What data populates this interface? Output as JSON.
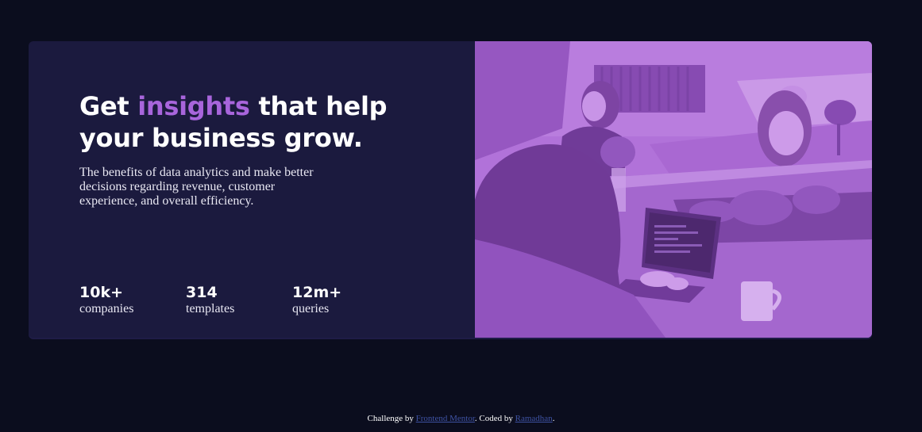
{
  "hero": {
    "headline_part1": "Get ",
    "headline_accent": "insights",
    "headline_part2": " that help your business grow.",
    "description": "The benefits of data analytics and make better decisions regarding revenue, customer experience, and overall efficiency."
  },
  "stats": [
    {
      "value": "10k+",
      "label": "companies"
    },
    {
      "value": "314",
      "label": "templates"
    },
    {
      "value": "12m+",
      "label": "queries"
    }
  ],
  "image": {
    "subject": "team-working-at-table-photo",
    "tint_color": "#aa5cdb"
  },
  "footer": {
    "prefix": "Challenge by ",
    "link1": "Frontend Mentor",
    "middle": ". Coded by ",
    "link2": "Ramadhan",
    "suffix": "."
  },
  "colors": {
    "page_background": "#0b0d1e",
    "card_background": "#1b1a3e",
    "accent": "#a865dc",
    "link": "#3e52a3"
  }
}
